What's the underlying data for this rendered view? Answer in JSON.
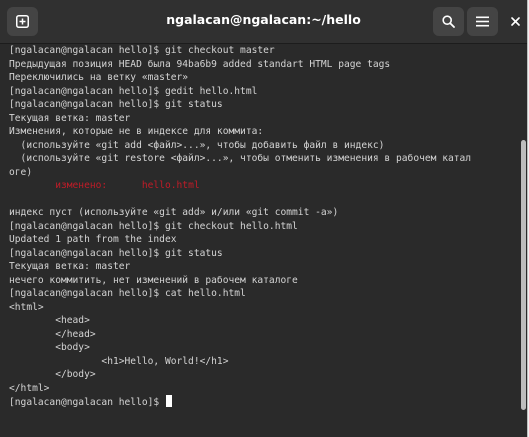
{
  "window": {
    "title": "ngalacan@ngalacan:~/hello"
  },
  "icons": {
    "new_tab": "new-tab-icon",
    "search": "search-icon",
    "menu": "hamburger-menu-icon",
    "close": "close-icon"
  },
  "colors": {
    "background": "#2a2a2a",
    "text": "#d4d4d4",
    "modified": "#c01c28",
    "titlebar": "#303030"
  },
  "terminal": {
    "lines": [
      "[ngalacan@ngalacan hello]$ git checkout master",
      "Предыдущая позиция HEAD была 94ba6b9 added standart HTML page tags",
      "Переключились на ветку «master»",
      "[ngalacan@ngalacan hello]$ gedit hello.html",
      "[ngalacan@ngalacan hello]$ git status",
      "Текущая ветка: master",
      "Изменения, которые не в индексе для коммита:",
      "  (используйте «git add <файл>...», чтобы добавить файл в индекс)",
      "  (используйте «git restore <файл>...», чтобы отменить изменения в рабочем катал",
      "оге)",
      "",
      "",
      "индекс пуст (используйте «git add» и/или «git commit -a»)",
      "[ngalacan@ngalacan hello]$ git checkout hello.html",
      "Updated 1 path from the index",
      "[ngalacan@ngalacan hello]$ git status",
      "Текущая ветка: master",
      "нечего коммитить, нет изменений в рабочем каталоге",
      "[ngalacan@ngalacan hello]$ cat hello.html",
      "<html>",
      "        <head>",
      "        </head>",
      "        <body>",
      "                <h1>Hello, World!</h1>",
      "        </body>",
      "</html>",
      "[ngalacan@ngalacan hello]$ "
    ],
    "modified_label": "        изменено:      ",
    "modified_file": "hello.html"
  }
}
